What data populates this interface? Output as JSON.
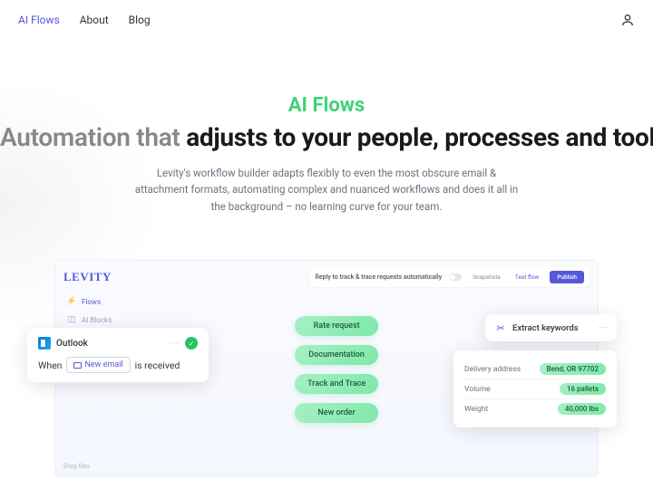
{
  "nav": {
    "links": [
      "AI Flows",
      "About",
      "Blog"
    ]
  },
  "hero": {
    "title_green": "AI Flows",
    "title_light": "Automation that ",
    "title_bold": "adjusts to your people, processes and tools",
    "subtitle": "Levity's workflow builder adapts flexibly to even the most obscure email & attachment formats, automating complex and nuanced workflows and does it all in the background – no learning curve for your team."
  },
  "product": {
    "logo": "LEVITY",
    "toolbar": {
      "title": "Reply to track & trace requests automatically",
      "item1": "Snapshots",
      "item2": "Test flow",
      "publish": "Publish"
    },
    "sidebar": {
      "flows": "Flows",
      "blocks": "AI Blocks"
    },
    "outlook": {
      "title": "Outlook",
      "when": "When",
      "chip": "New email",
      "received": "is received"
    },
    "chips": [
      "Rate request",
      "Documentation",
      "Track and Trace",
      "New order"
    ],
    "extract": {
      "title": "Extract keywords"
    },
    "fields": [
      {
        "label": "Delivery address",
        "value": "Bend, OR 97702"
      },
      {
        "label": "Volume",
        "value": "16 pallets"
      },
      {
        "label": "Weight",
        "value": "40,000 lbs"
      }
    ],
    "footer": "Drag files"
  }
}
